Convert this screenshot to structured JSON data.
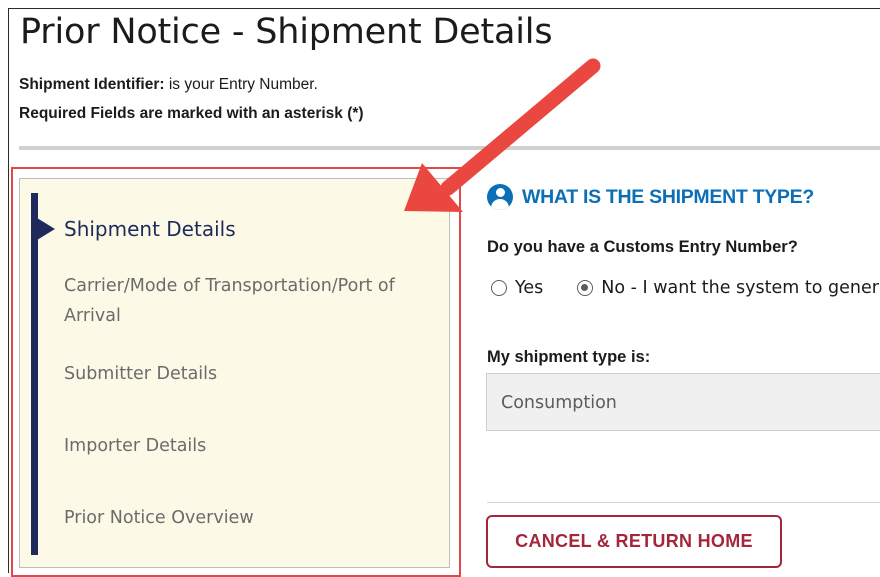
{
  "header": {
    "title": "Prior Notice - Shipment Details",
    "identifier_label": "Shipment Identifier:",
    "identifier_text": " is your Entry Number.",
    "required_note": "Required Fields are marked with an asterisk (*)"
  },
  "nav": {
    "items": [
      {
        "label": "Shipment Details",
        "active": true
      },
      {
        "label": "Carrier/Mode of Transportation/Port of Arrival",
        "active": false
      },
      {
        "label": "Submitter Details",
        "active": false
      },
      {
        "label": "Importer Details",
        "active": false
      },
      {
        "label": "Prior Notice Overview",
        "active": false
      }
    ]
  },
  "form": {
    "heading": "WHAT IS THE SHIPMENT TYPE?",
    "customs_question": "Do you have a Customs Entry Number?",
    "radio_options": {
      "yes": "Yes",
      "no": "No - I want the system to generate"
    },
    "selected_option": "no",
    "shipment_type_label": "My shipment type is:",
    "shipment_type_value": "Consumption",
    "cancel_button": "CANCEL & RETURN HOME"
  },
  "colors": {
    "accent_blue": "#0b6fb8",
    "nav_dark": "#1f2a5c",
    "nav_bg": "#fcfae6",
    "cancel_red": "#a3263a",
    "annotation_red": "#e9473f"
  },
  "icons": {
    "heading_icon": "user-circle-icon",
    "annotation": "red-arrow-icon"
  }
}
